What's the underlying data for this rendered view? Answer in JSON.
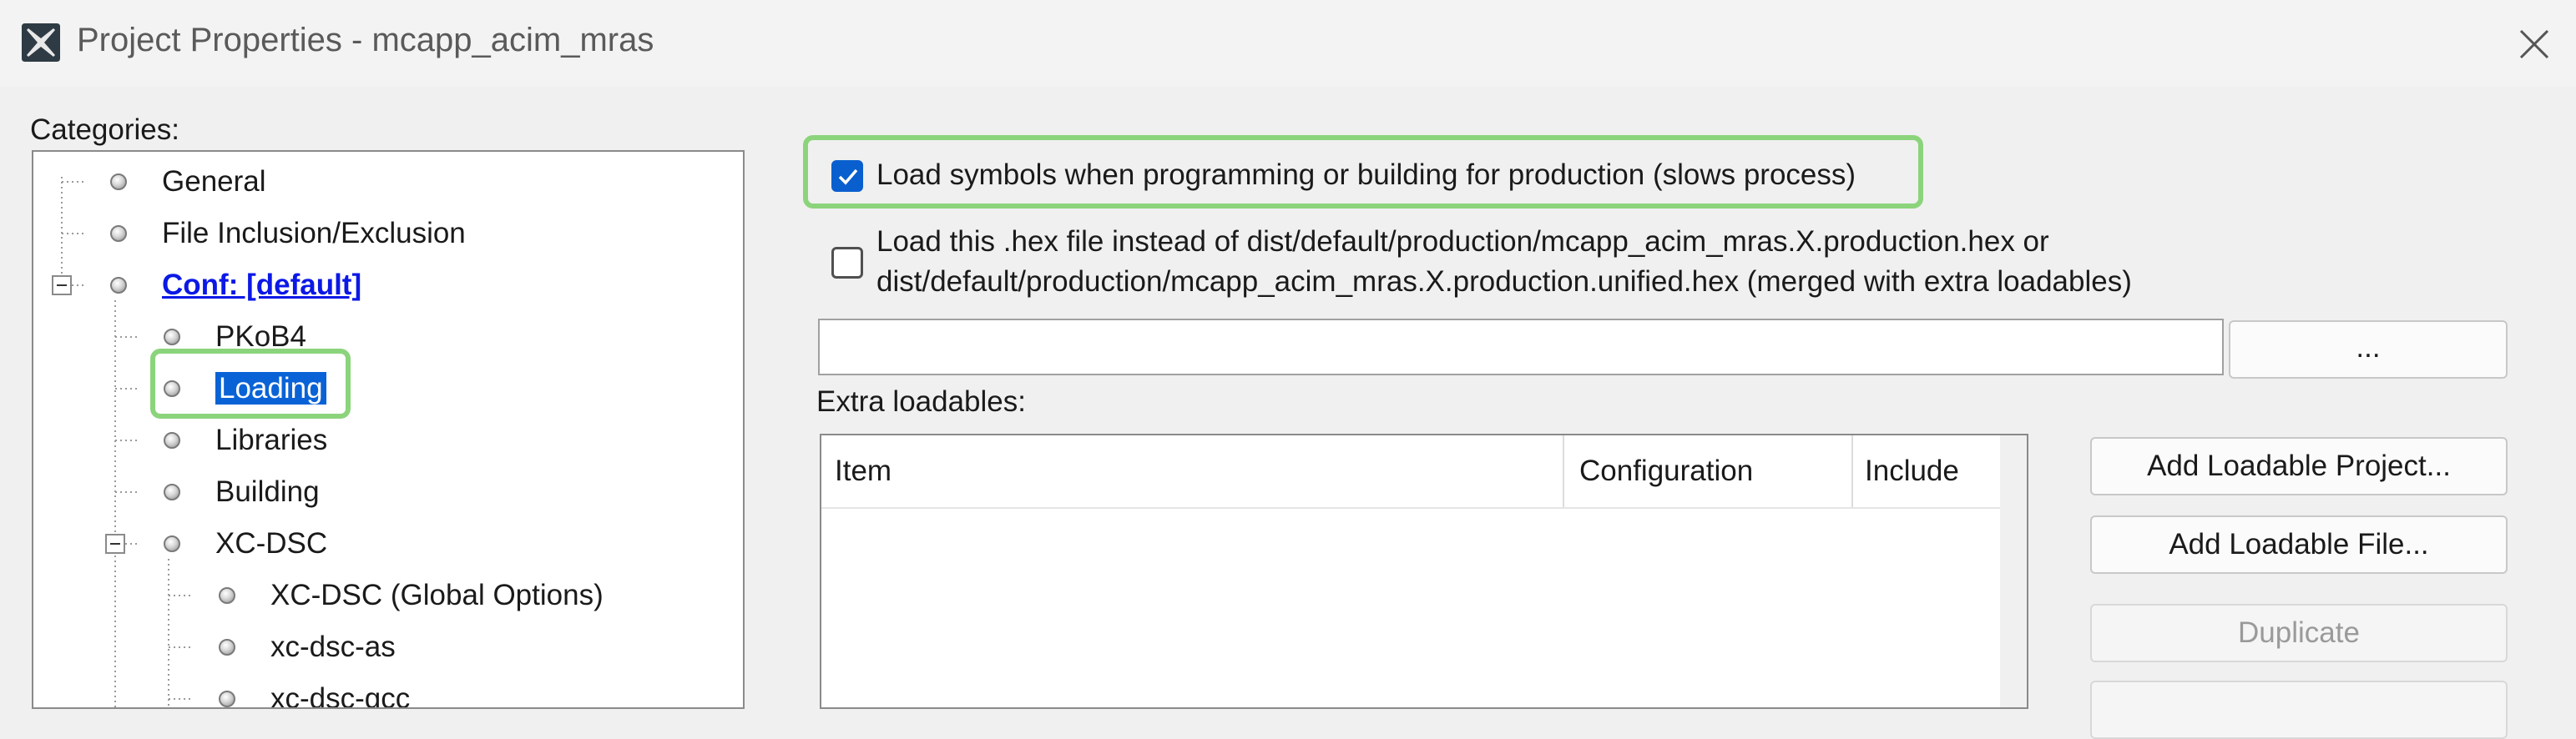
{
  "window": {
    "title": "Project Properties - mcapp_acim_mras",
    "icon": "mplab-x-icon",
    "close_icon": "close-icon"
  },
  "categories": {
    "label": "Categories:",
    "items": [
      {
        "label": "General",
        "level": 0
      },
      {
        "label": "File Inclusion/Exclusion",
        "level": 0
      },
      {
        "label": "Conf: [default]",
        "level": 0,
        "expanded": true,
        "link": true
      },
      {
        "label": "PKoB4",
        "level": 1
      },
      {
        "label": "Loading",
        "level": 1,
        "selected": true
      },
      {
        "label": "Libraries",
        "level": 1
      },
      {
        "label": "Building",
        "level": 1
      },
      {
        "label": "XC-DSC",
        "level": 1,
        "expanded": true
      },
      {
        "label": "XC-DSC (Global Options)",
        "level": 2
      },
      {
        "label": "xc-dsc-as",
        "level": 2
      },
      {
        "label": "xc-dsc-gcc",
        "level": 2
      }
    ]
  },
  "loading": {
    "load_symbols": {
      "label": "Load symbols when programming or building for production (slows process)",
      "checked": true
    },
    "load_hex": {
      "label_line1": "Load this .hex file instead of dist/default/production/mcapp_acim_mras.X.production.hex or",
      "label_line2": "dist/default/production/mcapp_acim_mras.X.production.unified.hex (merged with extra loadables)",
      "checked": false
    },
    "hex_path_value": "",
    "browse_label": "...",
    "extra_loadables_label": "Extra loadables:",
    "table": {
      "columns": [
        "Item",
        "Configuration",
        "Include"
      ],
      "rows": []
    },
    "buttons": {
      "add_project": "Add Loadable Project...",
      "add_file": "Add Loadable File...",
      "duplicate": "Duplicate"
    }
  },
  "colors": {
    "highlight": "#8bd47c",
    "selection": "#0a63d6",
    "link": "#0b18e6",
    "checkbox_checked": "#0a5fcf"
  }
}
